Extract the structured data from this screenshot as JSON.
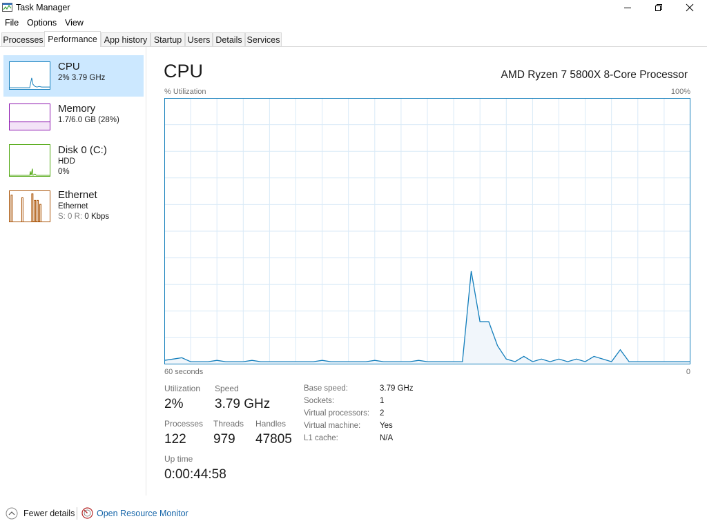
{
  "window": {
    "title": "Task Manager"
  },
  "menu": [
    "File",
    "Options",
    "View"
  ],
  "tabs": [
    {
      "label": "Processes",
      "active": false
    },
    {
      "label": "Performance",
      "active": true
    },
    {
      "label": "App history",
      "active": false
    },
    {
      "label": "Startup",
      "active": false
    },
    {
      "label": "Users",
      "active": false
    },
    {
      "label": "Details",
      "active": false
    },
    {
      "label": "Services",
      "active": false
    }
  ],
  "sidebar": [
    {
      "title": "CPU",
      "line1": "2%  3.79 GHz",
      "color": "#117dbb",
      "selected": true
    },
    {
      "title": "Memory",
      "line1": "1.7/6.0 GB (28%)",
      "color": "#8b12ae",
      "selected": false
    },
    {
      "title": "Disk 0 (C:)",
      "line1": "HDD",
      "line2": "0%",
      "color": "#4da60c",
      "selected": false
    },
    {
      "title": "Ethernet",
      "line1": "Ethernet",
      "line2_prefix": "S: 0  R: ",
      "line2_suffix": "0 Kbps",
      "color": "#a74f01",
      "selected": false
    }
  ],
  "main": {
    "title": "CPU",
    "processor": "AMD Ryzen 7 5800X 8-Core Processor",
    "y_label": "% Utilization",
    "y_max_label": "100%",
    "x_left_label": "60 seconds",
    "x_right_label": "0"
  },
  "chart_data": {
    "type": "area",
    "x_start": 60,
    "x_end": 0,
    "ylim": [
      0,
      100
    ],
    "grid": true,
    "color": "#117dbb",
    "values": [
      1.5,
      2,
      2.5,
      1,
      1,
      1,
      1.5,
      1,
      1,
      1,
      1.5,
      1,
      1,
      1,
      1,
      1,
      1,
      1,
      1.5,
      1,
      1,
      1,
      1,
      1,
      1.5,
      1,
      1,
      1,
      1,
      1.5,
      1,
      1,
      1,
      1,
      1,
      35,
      16,
      16,
      7,
      2,
      1,
      3,
      1,
      2,
      1,
      2,
      1,
      2,
      1,
      3,
      2,
      1,
      5.5,
      1,
      1,
      1,
      1,
      1,
      1,
      1,
      1
    ]
  },
  "stats": {
    "utilization": {
      "label": "Utilization",
      "value": "2%"
    },
    "speed": {
      "label": "Speed",
      "value": "3.79 GHz"
    },
    "processes": {
      "label": "Processes",
      "value": "122"
    },
    "threads": {
      "label": "Threads",
      "value": "979"
    },
    "handles": {
      "label": "Handles",
      "value": "47805"
    },
    "uptime": {
      "label": "Up time",
      "value": "0:00:44:58"
    }
  },
  "specs": [
    {
      "label": "Base speed:",
      "value": "3.79 GHz"
    },
    {
      "label": "Sockets:",
      "value": "1"
    },
    {
      "label": "Virtual processors:",
      "value": "2"
    },
    {
      "label": "Virtual machine:",
      "value": "Yes"
    },
    {
      "label": "L1 cache:",
      "value": "N/A"
    }
  ],
  "footer": {
    "fewer_details": "Fewer details",
    "resource_monitor": "Open Resource Monitor"
  }
}
